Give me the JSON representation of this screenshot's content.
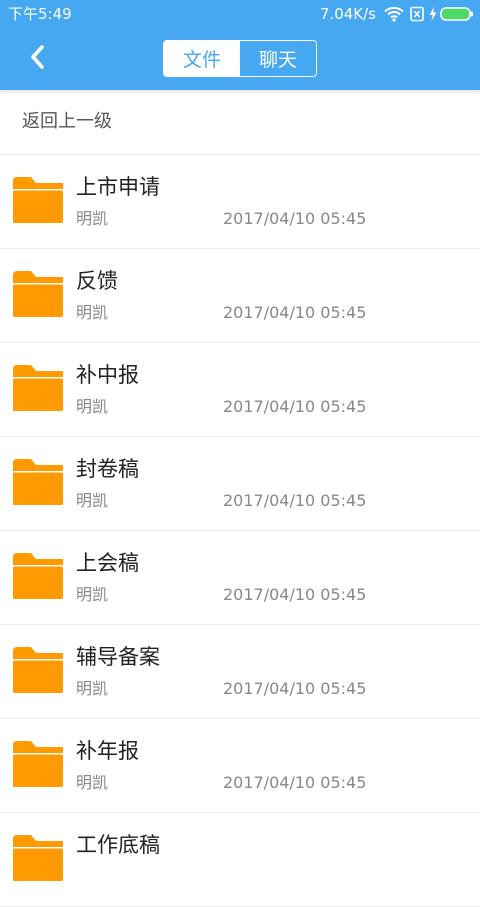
{
  "status_bar": {
    "time": "下午5:49",
    "net_speed": "7.04K/s"
  },
  "header": {
    "tabs": [
      {
        "label": "文件",
        "active": true
      },
      {
        "label": "聊天",
        "active": false
      }
    ]
  },
  "nav": {
    "up_level_label": "返回上一级"
  },
  "files": [
    {
      "name": "上市申请",
      "owner": "明凯",
      "date": "2017/04/10 05:45"
    },
    {
      "name": "反馈",
      "owner": "明凯",
      "date": "2017/04/10 05:45"
    },
    {
      "name": "补中报",
      "owner": "明凯",
      "date": "2017/04/10 05:45"
    },
    {
      "name": "封卷稿",
      "owner": "明凯",
      "date": "2017/04/10 05:45"
    },
    {
      "name": "上会稿",
      "owner": "明凯",
      "date": "2017/04/10 05:45"
    },
    {
      "name": "辅导备案",
      "owner": "明凯",
      "date": "2017/04/10 05:45"
    },
    {
      "name": "补年报",
      "owner": "明凯",
      "date": "2017/04/10 05:45"
    },
    {
      "name": "工作底稿",
      "owner": "",
      "date": ""
    }
  ],
  "colors": {
    "header_blue": "#46a8f0",
    "folder_orange": "#ff9a00",
    "battery_green": "#4cd964"
  },
  "icons": {
    "back": "chevron-left-icon",
    "folder": "folder-icon",
    "wifi": "wifi-icon",
    "sim": "no-sim-icon",
    "charging": "lightning-icon",
    "battery": "battery-icon"
  }
}
